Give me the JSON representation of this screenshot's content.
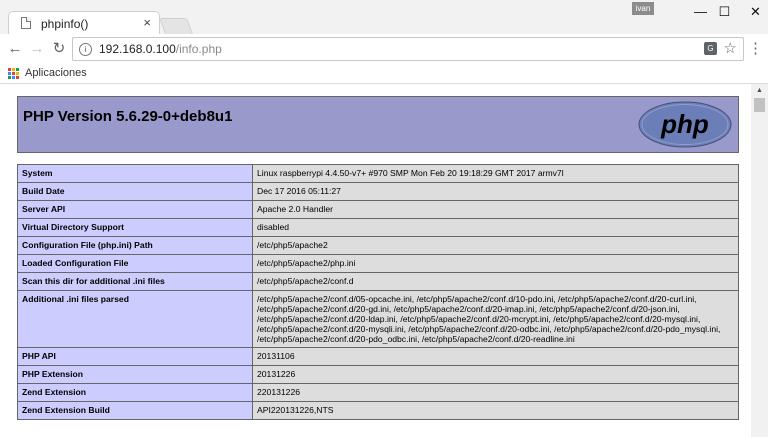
{
  "browser": {
    "tab_title": "phpinfo()",
    "tab_close": "×",
    "user_badge": "ivan",
    "window_buttons": {
      "minimize": "—",
      "maximize": "☐",
      "close": "✕"
    },
    "url_host": "192.168.0.100",
    "url_path": "/info.php",
    "bookmarks_apps_label": "Aplicaciones",
    "apps_colors": [
      "#db4437",
      "#f4b400",
      "#0f9d58",
      "#4285f4",
      "#db4437",
      "#f4b400",
      "#0f9d58",
      "#4285f4",
      "#db4437"
    ]
  },
  "page": {
    "header_title": "PHP Version 5.6.29-0+deb8u1",
    "logo_text": "php",
    "rows": [
      {
        "key": "System",
        "value": "Linux raspberrypi 4.4.50-v7+ #970 SMP Mon Feb 20 19:18:29 GMT 2017 armv7l"
      },
      {
        "key": "Build Date",
        "value": "Dec 17 2016 05:11:27"
      },
      {
        "key": "Server API",
        "value": "Apache 2.0 Handler"
      },
      {
        "key": "Virtual Directory Support",
        "value": "disabled"
      },
      {
        "key": "Configuration File (php.ini) Path",
        "value": "/etc/php5/apache2"
      },
      {
        "key": "Loaded Configuration File",
        "value": "/etc/php5/apache2/php.ini"
      },
      {
        "key": "Scan this dir for additional .ini files",
        "value": "/etc/php5/apache2/conf.d"
      },
      {
        "key": "Additional .ini files parsed",
        "value": "/etc/php5/apache2/conf.d/05-opcache.ini, /etc/php5/apache2/conf.d/10-pdo.ini, /etc/php5/apache2/conf.d/20-curl.ini, /etc/php5/apache2/conf.d/20-gd.ini, /etc/php5/apache2/conf.d/20-imap.ini, /etc/php5/apache2/conf.d/20-json.ini, /etc/php5/apache2/conf.d/20-ldap.ini, /etc/php5/apache2/conf.d/20-mcrypt.ini, /etc/php5/apache2/conf.d/20-mysql.ini, /etc/php5/apache2/conf.d/20-mysqli.ini, /etc/php5/apache2/conf.d/20-odbc.ini, /etc/php5/apache2/conf.d/20-pdo_mysql.ini, /etc/php5/apache2/conf.d/20-pdo_odbc.ini, /etc/php5/apache2/conf.d/20-readline.ini"
      },
      {
        "key": "PHP API",
        "value": "20131106"
      },
      {
        "key": "PHP Extension",
        "value": "20131226"
      },
      {
        "key": "Zend Extension",
        "value": "220131226"
      },
      {
        "key": "Zend Extension Build",
        "value": "API220131226,NTS"
      }
    ]
  }
}
